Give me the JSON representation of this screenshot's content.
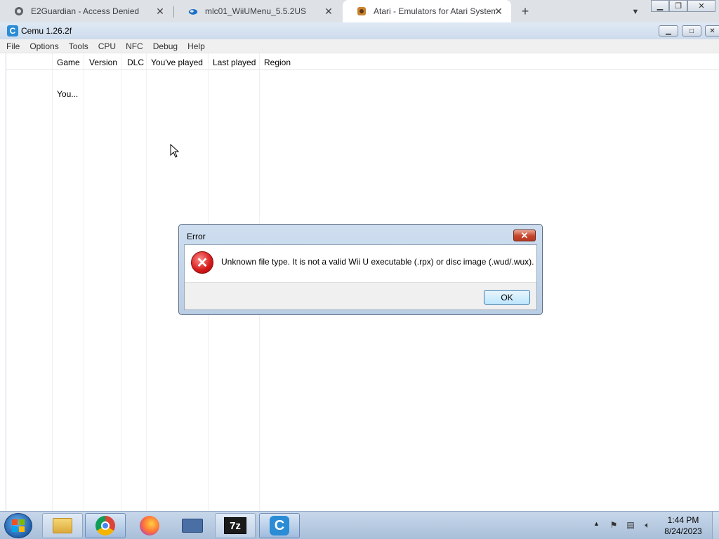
{
  "browser": {
    "tabs": [
      {
        "label": "E2Guardian - Access Denied",
        "icon": "globe-icon"
      },
      {
        "label": "mlc01_WiiUMenu_5.5.2US",
        "icon": "cloud-icon"
      },
      {
        "label": "Atari - Emulators for Atari System",
        "icon": "game-icon"
      }
    ],
    "new_tab": "+",
    "close_glyph": "✕"
  },
  "window": {
    "title": "Cemu 1.26.2f",
    "logo": "C"
  },
  "menu": [
    "File",
    "Options",
    "Tools",
    "CPU",
    "NFC",
    "Debug",
    "Help"
  ],
  "table": {
    "columns": [
      "Game",
      "Version",
      "DLC",
      "You've played",
      "Last played",
      "Region"
    ],
    "rows": [
      {
        "game": "You..."
      }
    ]
  },
  "dialog": {
    "title": "Error",
    "message": "Unknown file type. It is not a valid Wii U executable (.rpx) or disc image (.wud/.wux).",
    "ok_label": "OK",
    "icon": "error-icon",
    "close_glyph": "✕"
  },
  "taskbar": {
    "apps": [
      "file-explorer",
      "chrome",
      "firefox",
      "on-screen-keyboard",
      "7-zip",
      "cemu"
    ],
    "sevenzip_label": "7z",
    "cemu_label": "C",
    "clock_time": "1:44 PM",
    "clock_date": "8/24/2023"
  },
  "colors": {
    "accent": "#2b8cd6",
    "error_red": "#d41818",
    "taskbar": "#b5c8df"
  }
}
